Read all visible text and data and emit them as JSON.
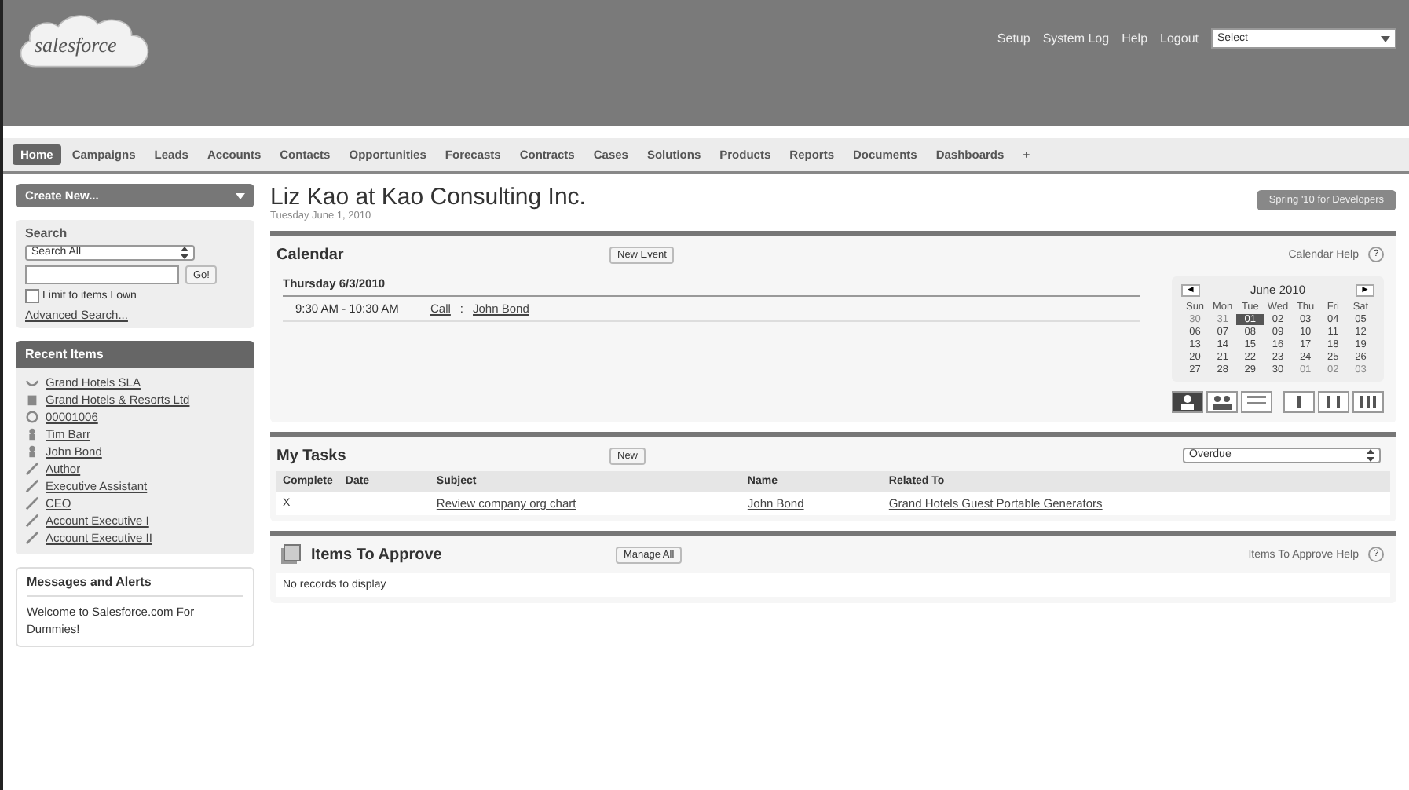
{
  "header": {
    "logo": "salesforce",
    "links": [
      "Setup",
      "System Log",
      "Help",
      "Logout"
    ],
    "app_select": "Select"
  },
  "tabs": [
    {
      "label": "Home",
      "selected": true
    },
    {
      "label": "Campaigns",
      "selected": false
    },
    {
      "label": "Leads",
      "selected": false
    },
    {
      "label": "Accounts",
      "selected": false
    },
    {
      "label": "Contacts",
      "selected": false
    },
    {
      "label": "Opportunities",
      "selected": false
    },
    {
      "label": "Forecasts",
      "selected": false
    },
    {
      "label": "Contracts",
      "selected": false
    },
    {
      "label": "Cases",
      "selected": false
    },
    {
      "label": "Solutions",
      "selected": false
    },
    {
      "label": "Products",
      "selected": false
    },
    {
      "label": "Reports",
      "selected": false
    },
    {
      "label": "Documents",
      "selected": false
    },
    {
      "label": "Dashboards",
      "selected": false
    },
    {
      "label": "+",
      "selected": false
    }
  ],
  "sidebar": {
    "create_new": "Create New...",
    "search": {
      "title": "Search",
      "scope": "Search All",
      "button": "Go!",
      "limit_label": "Limit to items I own",
      "limit_checked": false,
      "advanced": "Advanced Search..."
    },
    "recent": {
      "title": "Recent Items",
      "items": [
        {
          "kind": "sla",
          "label": "Grand Hotels SLA"
        },
        {
          "kind": "account",
          "label": "Grand Hotels & Resorts Ltd"
        },
        {
          "kind": "case",
          "label": "00001006"
        },
        {
          "kind": "contact",
          "label": "Tim Barr"
        },
        {
          "kind": "contact",
          "label": "John Bond"
        },
        {
          "kind": "role",
          "label": "Author"
        },
        {
          "kind": "role",
          "label": "Executive Assistant"
        },
        {
          "kind": "role",
          "label": "CEO"
        },
        {
          "kind": "role",
          "label": "Account Executive I"
        },
        {
          "kind": "role",
          "label": "Account Executive II"
        }
      ]
    },
    "messages": {
      "title": "Messages and Alerts",
      "text": "Welcome to Salesforce.com For Dummies!"
    }
  },
  "page": {
    "title": "Liz Kao at Kao Consulting Inc.",
    "date": "Tuesday June 1, 2010",
    "top_button": "Spring '10 for Developers"
  },
  "calendar": {
    "title": "Calendar",
    "new_button": "New Event",
    "help": "Calendar Help",
    "help_mark": "?",
    "day": "Thursday 6/3/2010",
    "events": [
      {
        "time": "9:30 AM - 10:30 AM",
        "type": "Call",
        "sep": ":",
        "who": "John Bond"
      }
    ],
    "mini": {
      "prev": "◄",
      "month": "June 2010",
      "next": "►",
      "weekdays": [
        "Sun",
        "Mon",
        "Tue",
        "Wed",
        "Thu",
        "Fri",
        "Sat"
      ],
      "weeks": [
        [
          {
            "d": "30",
            "other": true,
            "selected": false
          },
          {
            "d": "31",
            "other": true,
            "selected": false
          },
          {
            "d": "01",
            "other": false,
            "selected": true
          },
          {
            "d": "02",
            "other": false,
            "selected": false
          },
          {
            "d": "03",
            "other": false,
            "selected": false
          },
          {
            "d": "04",
            "other": false,
            "selected": false
          },
          {
            "d": "05",
            "other": false,
            "selected": false
          }
        ],
        [
          {
            "d": "06",
            "other": false,
            "selected": false
          },
          {
            "d": "07",
            "other": false,
            "selected": false
          },
          {
            "d": "08",
            "other": false,
            "selected": false
          },
          {
            "d": "09",
            "other": false,
            "selected": false
          },
          {
            "d": "10",
            "other": false,
            "selected": false
          },
          {
            "d": "11",
            "other": false,
            "selected": false
          },
          {
            "d": "12",
            "other": false,
            "selected": false
          }
        ],
        [
          {
            "d": "13",
            "other": false,
            "selected": false
          },
          {
            "d": "14",
            "other": false,
            "selected": false
          },
          {
            "d": "15",
            "other": false,
            "selected": false
          },
          {
            "d": "16",
            "other": false,
            "selected": false
          },
          {
            "d": "17",
            "other": false,
            "selected": false
          },
          {
            "d": "18",
            "other": false,
            "selected": false
          },
          {
            "d": "19",
            "other": false,
            "selected": false
          }
        ],
        [
          {
            "d": "20",
            "other": false,
            "selected": false
          },
          {
            "d": "21",
            "other": false,
            "selected": false
          },
          {
            "d": "22",
            "other": false,
            "selected": false
          },
          {
            "d": "23",
            "other": false,
            "selected": false
          },
          {
            "d": "24",
            "other": false,
            "selected": false
          },
          {
            "d": "25",
            "other": false,
            "selected": false
          },
          {
            "d": "26",
            "other": false,
            "selected": false
          }
        ],
        [
          {
            "d": "27",
            "other": false,
            "selected": false
          },
          {
            "d": "28",
            "other": false,
            "selected": false
          },
          {
            "d": "29",
            "other": false,
            "selected": false
          },
          {
            "d": "30",
            "other": false,
            "selected": false
          },
          {
            "d": "01",
            "other": true,
            "selected": false
          },
          {
            "d": "02",
            "other": true,
            "selected": false
          },
          {
            "d": "03",
            "other": true,
            "selected": false
          }
        ]
      ]
    },
    "views": [
      {
        "kind": "person",
        "selected": true
      },
      {
        "kind": "multi",
        "selected": false
      },
      {
        "kind": "list",
        "selected": false
      },
      {
        "kind": "day",
        "selected": false
      },
      {
        "kind": "week",
        "selected": false
      },
      {
        "kind": "month",
        "selected": false
      }
    ]
  },
  "tasks": {
    "title": "My Tasks",
    "new_button": "New",
    "filter": "Overdue",
    "columns": [
      "Complete",
      "Date",
      "Subject",
      "Name",
      "Related To"
    ],
    "rows": [
      {
        "complete": "X",
        "subject": "Review company org chart",
        "name": "John Bond",
        "related": "Grand Hotels Guest Portable Generators"
      }
    ]
  },
  "approvals": {
    "title": "Items To Approve",
    "manage_button": "Manage All",
    "help": "Items To Approve Help",
    "help_mark": "?",
    "empty": "No records to display"
  }
}
